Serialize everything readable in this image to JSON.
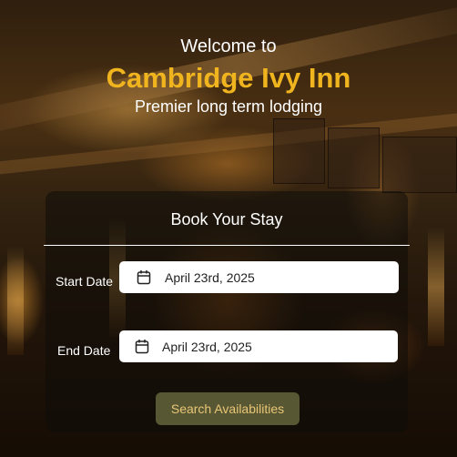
{
  "hero": {
    "welcome": "Welcome to",
    "brand": "Cambridge Ivy Inn",
    "tagline": "Premier long term lodging"
  },
  "booking": {
    "title": "Book Your Stay",
    "start_label": "Start Date",
    "start_value": "April 23rd, 2025",
    "end_label": "End Date",
    "end_value": "April 23rd, 2025",
    "search_label": "Search Availabilities",
    "calendar_icon": "calendar-icon"
  },
  "colors": {
    "brand": "#f0b51e",
    "button_bg": "#575733",
    "button_text": "#e9c676"
  }
}
